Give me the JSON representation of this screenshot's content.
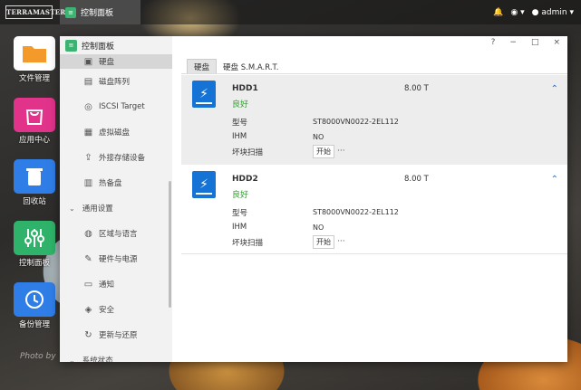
{
  "topbar": {
    "logo_text": "TERRAMASTER",
    "tab_label": "控制面板",
    "user": "admin",
    "icons": [
      "bell-icon",
      "globe-icon",
      "user-icon"
    ]
  },
  "desktop": {
    "icons": [
      {
        "label": "文件管理",
        "color": "#f39a2b"
      },
      {
        "label": "应用中心",
        "color": "#e1338a"
      },
      {
        "label": "回收站",
        "color": "#2f7ee8"
      },
      {
        "label": "控制面板",
        "color": "#2fb36a"
      },
      {
        "label": "备份管理",
        "color": "#2f7ee8"
      }
    ],
    "watermark": "Photo by"
  },
  "sidebar": {
    "title": "控制面板",
    "items": [
      {
        "label": "硬盘",
        "icon": "disk-icon",
        "selected": true
      },
      {
        "label": "磁盘阵列",
        "icon": "raid-icon"
      },
      {
        "label": "ISCSI Target",
        "icon": "iscsi-icon"
      },
      {
        "label": "虚拟磁盘",
        "icon": "virtual-disk-icon"
      },
      {
        "label": "外接存储设备",
        "icon": "external-storage-icon"
      },
      {
        "label": "热备盘",
        "icon": "hot-spare-icon"
      }
    ],
    "group_general": "通用设置",
    "general_items": [
      {
        "label": "区域与语言",
        "icon": "globe-icon"
      },
      {
        "label": "硬件与电源",
        "icon": "wrench-icon"
      },
      {
        "label": "通知",
        "icon": "message-icon"
      },
      {
        "label": "安全",
        "icon": "shield-icon"
      },
      {
        "label": "更新与还原",
        "icon": "refresh-icon"
      }
    ],
    "group_status": "系统状态"
  },
  "window": {
    "controls": [
      "?",
      "−",
      "□",
      "×"
    ]
  },
  "tabs": [
    "硬盘",
    "硬盘 S.M.A.R.T."
  ],
  "disks": [
    {
      "name": "HDD1",
      "status": "良好",
      "size": "8.00 T",
      "model_label": "型号",
      "model": "ST8000VN0022-2EL112",
      "ihm_label": "IHM",
      "ihm": "NO",
      "scan_label": "坏块扫描",
      "scan_button": "开始",
      "more": "···"
    },
    {
      "name": "HDD2",
      "status": "良好",
      "size": "8.00 T",
      "model_label": "型号",
      "model": "ST8000VN0022-2EL112",
      "ihm_label": "IHM",
      "ihm": "NO",
      "scan_label": "坏块扫描",
      "scan_button": "开始",
      "more": "···"
    }
  ],
  "colors": {
    "accent": "#1473d4",
    "good": "#2f9e2f",
    "brand_green": "#3cb371"
  }
}
